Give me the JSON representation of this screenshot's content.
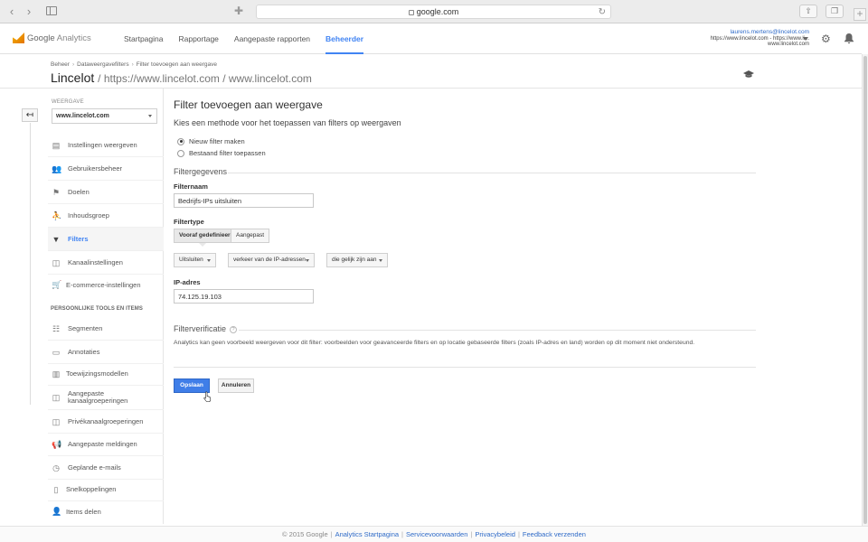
{
  "browser": {
    "url": "google.com"
  },
  "header": {
    "logo_text_1": "Google",
    "logo_text_2": "Analytics",
    "nav": [
      {
        "label": "Startpagina",
        "active": false
      },
      {
        "label": "Rapportage",
        "active": false
      },
      {
        "label": "Aangepaste rapporten",
        "active": false
      },
      {
        "label": "Beheerder",
        "active": true
      }
    ],
    "account_email": "laurens.mertens@lincelot.com",
    "account_line2": "https://www.lincelot.com - https://www.li...",
    "account_line3": "www.lincelot.com"
  },
  "page": {
    "breadcrumb": [
      "Beheer",
      "Dataweergavefilters",
      "Filter toevoegen aan weergave"
    ],
    "property_name": "Lincelot",
    "property_urls": "/ https://www.lincelot.com / www.lincelot.com"
  },
  "sidebar": {
    "view_label": "WEERGAVE",
    "view_value": "www.lincelot.com",
    "items": [
      {
        "label": "Instellingen weergeven",
        "icon": "document-icon"
      },
      {
        "label": "Gebruikersbeheer",
        "icon": "users-icon"
      },
      {
        "label": "Doelen",
        "icon": "flag-icon"
      },
      {
        "label": "Inhoudsgroep",
        "icon": "person-icon"
      },
      {
        "label": "Filters",
        "icon": "filter-icon",
        "active": true
      },
      {
        "label": "Kanaalinstellingen",
        "icon": "channel-icon"
      },
      {
        "label": "E-commerce-instellingen",
        "icon": "cart-icon"
      }
    ],
    "section_title": "PERSOONLIJKE TOOLS EN ITEMS",
    "tools": [
      {
        "label": "Segmenten",
        "icon": "segments-icon"
      },
      {
        "label": "Annotaties",
        "icon": "annotation-icon"
      },
      {
        "label": "Toewijzingsmodellen",
        "icon": "bars-icon"
      },
      {
        "label": "Aangepaste kanaalgroeperingen",
        "icon": "channel-group-icon"
      },
      {
        "label": "Privékanaalgroeperingen",
        "icon": "private-channel-icon"
      },
      {
        "label": "Aangepaste meldingen",
        "icon": "megaphone-icon"
      },
      {
        "label": "Geplande e-mails",
        "icon": "clock-icon"
      },
      {
        "label": "Snelkoppelingen",
        "icon": "shortcut-icon"
      },
      {
        "label": "Items delen",
        "icon": "share-user-icon"
      }
    ]
  },
  "form": {
    "title": "Filter toevoegen aan weergave",
    "subtitle": "Kies een methode voor het toepassen van filters op weergaven",
    "radio_new": "Nieuw filter maken",
    "radio_existing": "Bestaand filter toepassen",
    "section_details": "Filtergegevens",
    "filter_name_label": "Filternaam",
    "filter_name_value": "Bedrijfs-IPs uitsluiten",
    "filter_type_label": "Filtertype",
    "type_predefined": "Vooraf gedefinieerd",
    "type_custom": "Aangepast",
    "dd_action": "Uitsluiten",
    "dd_source": "verkeer van de IP-adressen",
    "dd_expression": "die gelijk zijn aan",
    "ip_label": "IP-adres",
    "ip_value": "74.125.19.103",
    "section_verification": "Filterverificatie",
    "verification_text": "Analytics kan geen voorbeeld weergeven voor dit filter: voorbeelden voor geavanceerde filters en op locatie gebaseerde filters (zoals IP-adres en land) worden op dit moment niet ondersteund.",
    "save_label": "Opslaan",
    "cancel_label": "Annuleren"
  },
  "footer": {
    "copyright": "© 2015 Google",
    "links": [
      "Analytics Startpagina",
      "Servicevoorwaarden",
      "Privacybeleid",
      "Feedback verzenden"
    ]
  },
  "colors": {
    "accent": "#4184f3",
    "save_button": "#3f7ee8"
  }
}
